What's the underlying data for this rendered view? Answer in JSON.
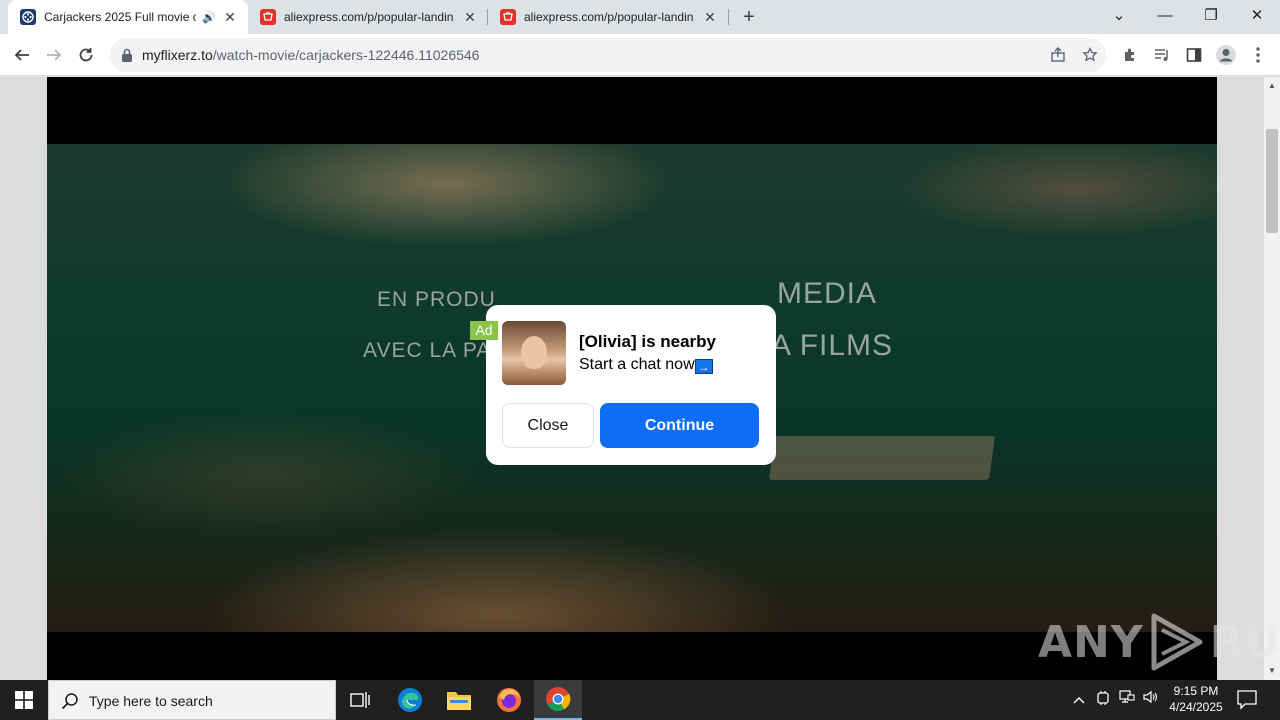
{
  "browser": {
    "tabs": [
      {
        "title": "Carjackers 2025 Full movie o",
        "active": true,
        "favicon": "film-reel-icon",
        "audio": true
      },
      {
        "title": "aliexpress.com/p/popular-landin",
        "active": false,
        "favicon": "aliexpress-icon"
      },
      {
        "title": "aliexpress.com/p/popular-landin",
        "active": false,
        "favicon": "aliexpress-icon"
      }
    ],
    "url": {
      "host": "myflixerz.to",
      "path": "/watch-movie/carjackers-122446.11026546"
    }
  },
  "video": {
    "line1_left": "EN PRODU",
    "line1_right": "MEDIA",
    "line2_left": "AVEC LA PA",
    "line2_right": "A FILMS"
  },
  "ad": {
    "badge": "Ad",
    "title": "[Olivia] is nearby",
    "subtitle": "Start a chat now",
    "arrow": "→",
    "close_label": "Close",
    "continue_label": "Continue",
    "accent": "#0f6df5"
  },
  "watermark": {
    "left": "ANY",
    "right": "RUN"
  },
  "taskbar": {
    "search_placeholder": "Type here to search",
    "apps": [
      "task-view-icon",
      "edge-icon",
      "file-explorer-icon",
      "firefox-icon",
      "chrome-icon"
    ],
    "time": "9:15 PM",
    "date": "4/24/2025"
  }
}
